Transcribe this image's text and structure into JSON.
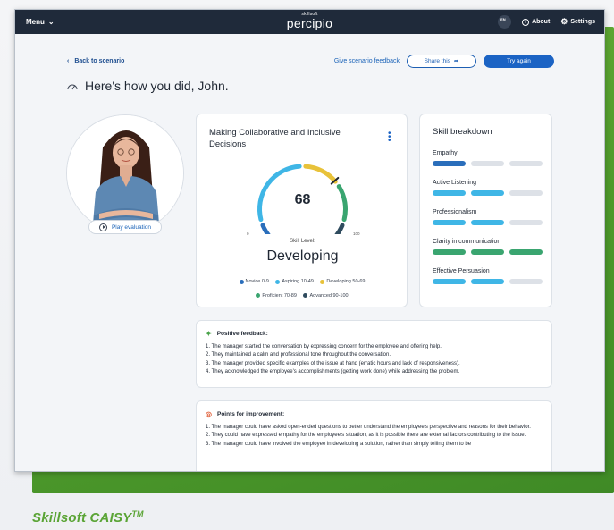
{
  "topbar": {
    "menu_label": "Menu",
    "logo_small": "skillsoft",
    "logo_big": "percipio",
    "lang": "EN",
    "about_label": "About",
    "settings_label": "Settings"
  },
  "subnav": {
    "back_label": "Back to scenario",
    "feedback_link": "Give scenario feedback",
    "share_label": "Share this",
    "try_again_label": "Try again"
  },
  "headline": "Here's how you did, John.",
  "avatar": {
    "play_label": "Play evaluation"
  },
  "score_card": {
    "title": "Making Collaborative and Inclusive Decisions",
    "score": "68",
    "score_value": 68,
    "min_label": "0",
    "max_label": "100",
    "skill_level_label": "Skill Level:",
    "skill_level_value": "Developing",
    "legend": [
      {
        "label": "Novice 0-9",
        "color": "#2a6ebb"
      },
      {
        "label": "Aspiring 10-49",
        "color": "#3fb6e6"
      },
      {
        "label": "Developing 50-69",
        "color": "#e8c23a"
      },
      {
        "label": "Proficient 70-89",
        "color": "#3aa570"
      },
      {
        "label": "Advanced 90-100",
        "color": "#2f4b5e"
      }
    ]
  },
  "skills_card": {
    "title": "Skill breakdown",
    "skills": [
      {
        "name": "Empathy",
        "bars": [
          "#2a6ebb",
          "#dde1e7",
          "#dde1e7"
        ]
      },
      {
        "name": "Active Listening",
        "bars": [
          "#3fb6e6",
          "#3fb6e6",
          "#dde1e7"
        ]
      },
      {
        "name": "Professionalism",
        "bars": [
          "#3fb6e6",
          "#3fb6e6",
          "#dde1e7"
        ]
      },
      {
        "name": "Clarity in communication",
        "bars": [
          "#3aa570",
          "#3aa570",
          "#3aa570"
        ]
      },
      {
        "name": "Effective Persuasion",
        "bars": [
          "#3fb6e6",
          "#3fb6e6",
          "#dde1e7"
        ]
      }
    ]
  },
  "positive": {
    "heading": "Positive feedback:",
    "items": [
      "1. The manager started the conversation by expressing concern for the employee and offering help.",
      "2. They maintained a calm and professional tone throughout the conversation.",
      "3. The manager provided specific examples of the issue at hand (erratic hours and lack of responsiveness).",
      "4. They acknowledged the employee's accomplishments (getting work done) while addressing the problem."
    ]
  },
  "improvement": {
    "heading": "Points for improvement:",
    "items": [
      "1. The manager could have asked open-ended questions to better understand the employee's perspective and reasons for their behavior.",
      "2. They could have expressed empathy for the employee's situation, as it is possible there are external factors contributing to the issue.",
      "3. The manager could have involved the employee in developing a solution, rather than simply telling them to be"
    ]
  },
  "caption": {
    "text": "Skillsoft CAISY",
    "tm": "TM"
  }
}
